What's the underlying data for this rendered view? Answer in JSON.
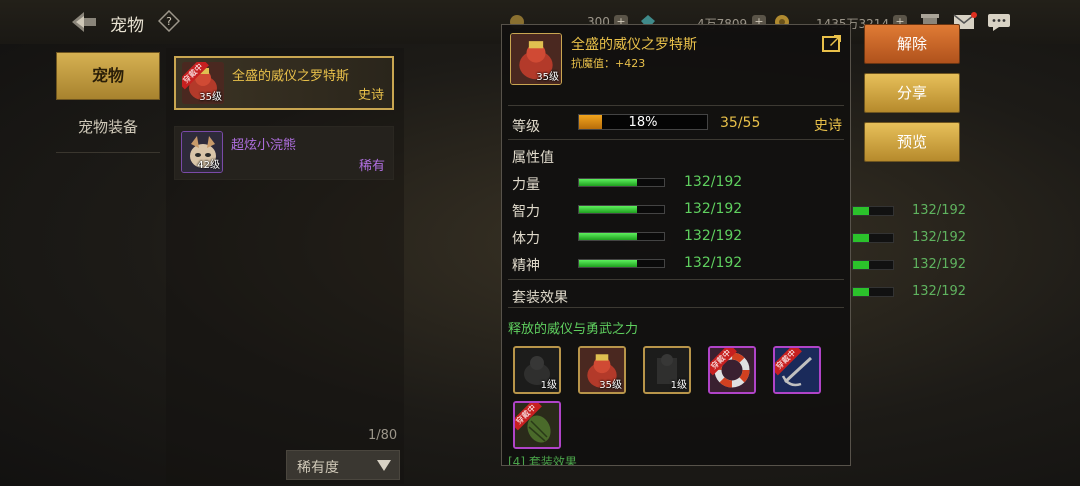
{
  "header": {
    "title": "宠物",
    "resources": [
      {
        "name": "gold-currency",
        "value": "300"
      },
      {
        "name": "gem-currency",
        "value": "4万7809"
      },
      {
        "name": "coin-currency",
        "value": "1435万3214"
      }
    ]
  },
  "menu": {
    "items": [
      {
        "label": "宠物",
        "active": true
      },
      {
        "label": "宠物装备",
        "active": false
      }
    ]
  },
  "pets": [
    {
      "name": "全盛的威仪之罗特斯",
      "level": "35级",
      "rarity": "史诗",
      "worn_tag": "穿戴中",
      "selected": true,
      "name_color": "#e8c04a",
      "rarity_color": "#e8c04a"
    },
    {
      "name": "超炫小浣熊",
      "level": "42级",
      "rarity": "稀有",
      "selected": false,
      "name_color": "#b06fe0",
      "rarity_color": "#b06fe0"
    }
  ],
  "list_footer": {
    "page_count": "1/80",
    "sort_label": "稀有度"
  },
  "background_stats": [
    "132/192",
    "132/192",
    "132/192",
    "132/192"
  ],
  "popup": {
    "name": "全盛的威仪之罗特斯",
    "sub_stat": "抗魔值：+423",
    "level_tag": "35级",
    "level": {
      "label": "等级",
      "percent_text": "18%",
      "progress": 0.18,
      "count": "35/55",
      "rarity": "史诗"
    },
    "attr_header": "属性值",
    "stats": [
      {
        "label": "力量",
        "value": "132/192",
        "progress": 0.6875
      },
      {
        "label": "智力",
        "value": "132/192",
        "progress": 0.6875
      },
      {
        "label": "体力",
        "value": "132/192",
        "progress": 0.6875
      },
      {
        "label": "精神",
        "value": "132/192",
        "progress": 0.6875
      }
    ],
    "set_header": "套装效果",
    "set_name": "释放的威仪与勇武之力",
    "set_items": [
      {
        "icon": "dim-creature-icon",
        "level": "1级",
        "worn": false,
        "dim": true,
        "border": "gold"
      },
      {
        "icon": "pet-icon",
        "level": "35级",
        "worn": false,
        "dim": false,
        "border": "gold"
      },
      {
        "icon": "dim-creature-icon",
        "level": "1级",
        "worn": false,
        "dim": true,
        "border": "gold"
      },
      {
        "icon": "life-ring-icon",
        "level": "",
        "worn": true,
        "worn_tag": "穿戴中",
        "dim": false,
        "border": "purple"
      },
      {
        "icon": "anchor-staff-icon",
        "level": "",
        "worn": true,
        "worn_tag": "穿戴中",
        "dim": false,
        "border": "purple"
      },
      {
        "icon": "grenade-icon",
        "level": "",
        "worn": true,
        "worn_tag": "穿戴中",
        "dim": false,
        "border": "purple"
      }
    ],
    "set_footer": "[4] 套装效果"
  },
  "buttons": {
    "remove": "解除",
    "share": "分享",
    "preview": "预览"
  },
  "colors": {
    "epic": "#e8c04a",
    "rare": "#b06fe0",
    "stat_green": "#5fd05f",
    "level_orange": "#f2a51e"
  }
}
